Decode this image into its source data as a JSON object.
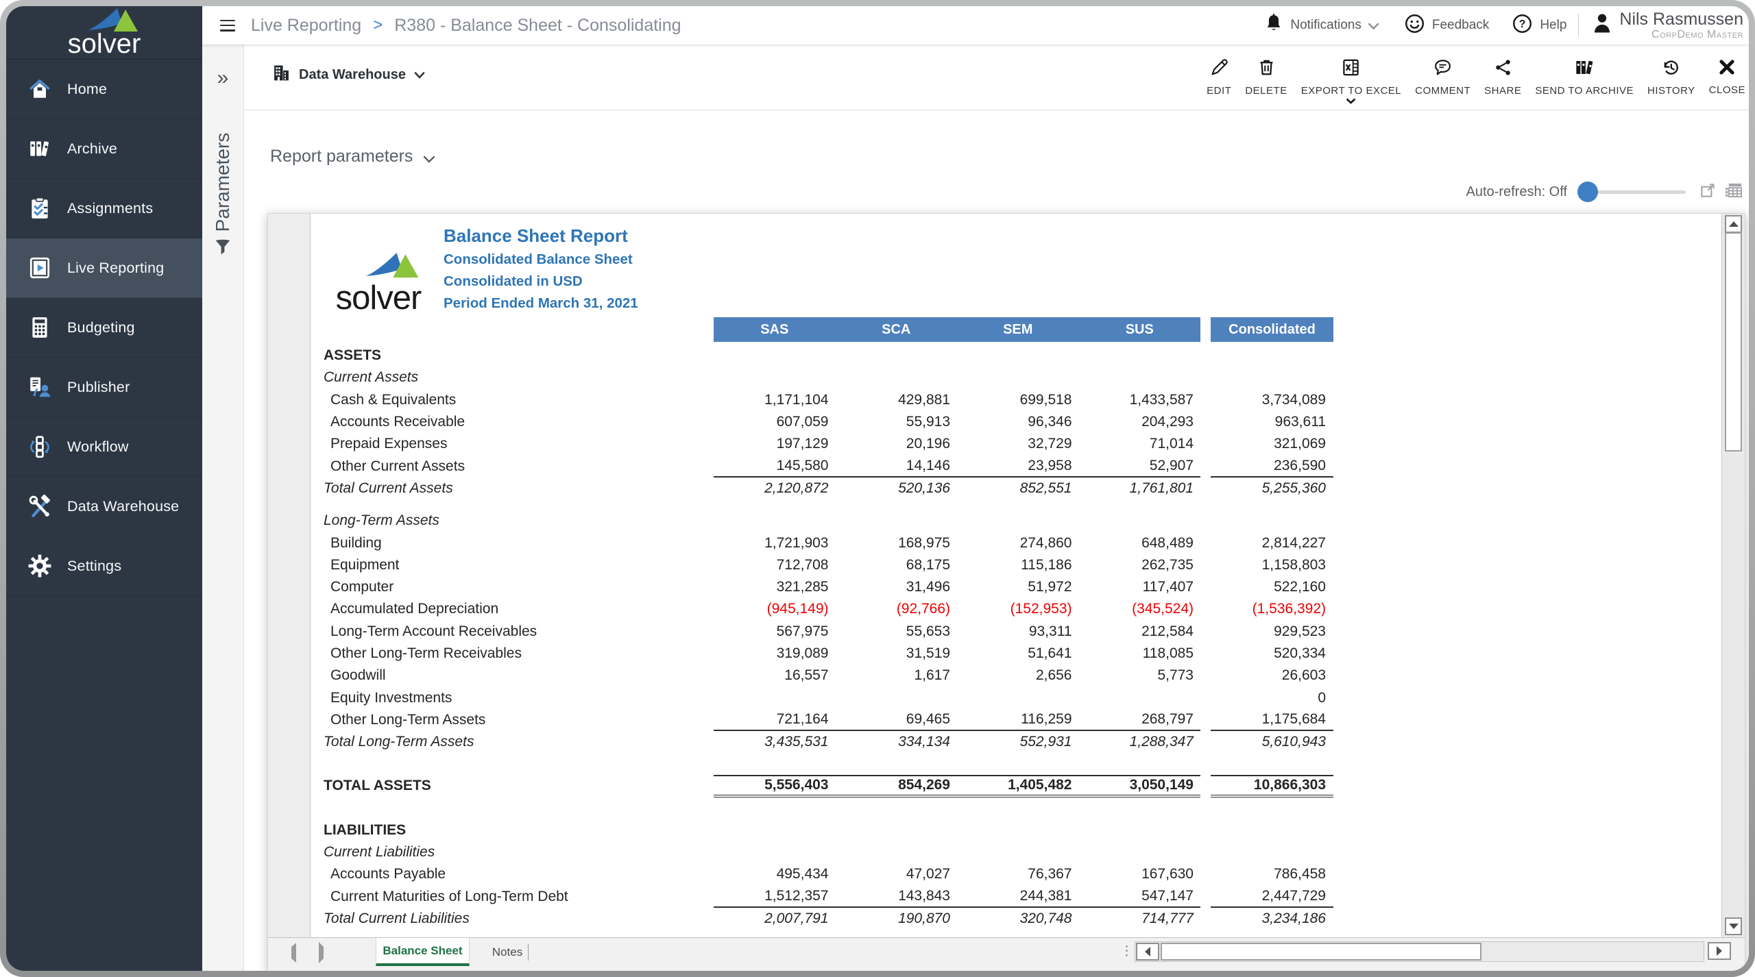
{
  "colors": {
    "sidebar-bg": "#2d3744",
    "sidebar-active": "#44505d",
    "accent-blue": "#3c7ddd",
    "icon-blue": "#4d8fd0",
    "band-blue": "#4f81bd",
    "title-blue": "#2e75b6",
    "neg-red": "#ee0000",
    "tab-green": "#1f7245",
    "knob-blue": "#3e80c3"
  },
  "sidebar": {
    "logo_text": "solver",
    "items": [
      {
        "label": "Home",
        "icon": "home-icon",
        "active": false
      },
      {
        "label": "Archive",
        "icon": "archive-icon",
        "active": false
      },
      {
        "label": "Assignments",
        "icon": "assignments-icon",
        "active": false
      },
      {
        "label": "Live Reporting",
        "icon": "live-reporting-icon",
        "active": true
      },
      {
        "label": "Budgeting",
        "icon": "budgeting-icon",
        "active": false
      },
      {
        "label": "Publisher",
        "icon": "publisher-icon",
        "active": false
      },
      {
        "label": "Workflow",
        "icon": "workflow-icon",
        "active": false
      },
      {
        "label": "Data Warehouse",
        "icon": "data-warehouse-icon",
        "active": false
      },
      {
        "label": "Settings",
        "icon": "settings-icon",
        "active": false
      }
    ]
  },
  "params_panel": {
    "title": "Parameters",
    "expand_glyph": "»"
  },
  "header": {
    "breadcrumb": {
      "section": "Live Reporting",
      "separator": ">",
      "page": "R380 - Balance Sheet - Consolidating"
    },
    "notifications_label": "Notifications",
    "feedback_label": "Feedback",
    "help_label": "Help",
    "user": {
      "name": "Nils Rasmussen",
      "org": "CorpDemo Master"
    }
  },
  "toolbar": {
    "source_label": "Data Warehouse",
    "actions": [
      {
        "label": "EDIT",
        "icon": "edit-icon",
        "has_dropdown": false
      },
      {
        "label": "DELETE",
        "icon": "delete-icon",
        "has_dropdown": false
      },
      {
        "label": "EXPORT TO EXCEL",
        "icon": "export-excel-icon",
        "has_dropdown": true
      },
      {
        "label": "COMMENT",
        "icon": "comment-icon",
        "has_dropdown": false
      },
      {
        "label": "SHARE",
        "icon": "share-icon",
        "has_dropdown": false
      },
      {
        "label": "SEND TO ARCHIVE",
        "icon": "send-to-archive-icon",
        "has_dropdown": false
      },
      {
        "label": "HISTORY",
        "icon": "history-icon",
        "has_dropdown": false
      },
      {
        "label": "CLOSE",
        "icon": "close-icon",
        "has_dropdown": false
      }
    ]
  },
  "report_parameters_label": "Report parameters",
  "auto_refresh": {
    "label": "Auto-refresh: Off"
  },
  "report": {
    "logo_text": "solver",
    "title": "Balance Sheet Report",
    "subtitles": [
      "Consolidated Balance Sheet",
      "Consolidated in USD",
      "Period Ended March 31, 2021"
    ],
    "columns": [
      "SAS",
      "SCA",
      "SEM",
      "SUS",
      "Consolidated"
    ],
    "rows": [
      {
        "style": "section",
        "label": "ASSETS"
      },
      {
        "style": "subsection",
        "label": "Current Assets"
      },
      {
        "style": "item",
        "label": "Cash & Equivalents",
        "values": [
          "1,171,104",
          "429,881",
          "699,518",
          "1,433,587",
          "3,734,089"
        ]
      },
      {
        "style": "item",
        "label": "Accounts Receivable",
        "values": [
          "607,059",
          "55,913",
          "96,346",
          "204,293",
          "963,611"
        ]
      },
      {
        "style": "item",
        "label": "Prepaid Expenses",
        "values": [
          "197,129",
          "20,196",
          "32,729",
          "71,014",
          "321,069"
        ]
      },
      {
        "style": "item underline",
        "label": "Other Current Assets",
        "values": [
          "145,580",
          "14,146",
          "23,958",
          "52,907",
          "236,590"
        ]
      },
      {
        "style": "total",
        "label": "Total Current Assets",
        "values": [
          "2,120,872",
          "520,136",
          "852,551",
          "1,761,801",
          "5,255,360"
        ]
      },
      {
        "style": "spacer",
        "h": 15
      },
      {
        "style": "subsection",
        "label": "Long-Term Assets"
      },
      {
        "style": "item",
        "label": "Building",
        "values": [
          "1,721,903",
          "168,975",
          "274,860",
          "648,489",
          "2,814,227"
        ]
      },
      {
        "style": "item",
        "label": "Equipment",
        "values": [
          "712,708",
          "68,175",
          "115,186",
          "262,735",
          "1,158,803"
        ]
      },
      {
        "style": "item",
        "label": "Computer",
        "values": [
          "321,285",
          "31,496",
          "51,972",
          "117,407",
          "522,160"
        ]
      },
      {
        "style": "item",
        "label": "Accumulated Depreciation",
        "values": [
          "(945,149)",
          "(92,766)",
          "(152,953)",
          "(345,524)",
          "(1,536,392)"
        ]
      },
      {
        "style": "item",
        "label": "Long-Term Account Receivables",
        "values": [
          "567,975",
          "55,653",
          "93,311",
          "212,584",
          "929,523"
        ]
      },
      {
        "style": "item",
        "label": "Other Long-Term Receivables",
        "values": [
          "319,089",
          "31,519",
          "51,641",
          "118,085",
          "520,334"
        ]
      },
      {
        "style": "item",
        "label": "Goodwill",
        "values": [
          "16,557",
          "1,617",
          "2,656",
          "5,773",
          "26,603"
        ]
      },
      {
        "style": "item",
        "label": "Equity Investments",
        "values": [
          "",
          "",
          "",
          "",
          "0"
        ]
      },
      {
        "style": "item underline",
        "label": "Other Long-Term Assets",
        "values": [
          "721,164",
          "69,465",
          "116,259",
          "268,797",
          "1,175,684"
        ]
      },
      {
        "style": "total",
        "label": "Total Long-Term Assets",
        "values": [
          "3,435,531",
          "334,134",
          "552,931",
          "1,288,347",
          "5,610,943"
        ]
      },
      {
        "style": "spacer",
        "h": 32
      },
      {
        "style": "grand",
        "label": "TOTAL ASSETS",
        "values": [
          "5,556,403",
          "854,269",
          "1,405,482",
          "3,050,149",
          "10,866,303"
        ]
      },
      {
        "style": "spacer",
        "h": 32
      },
      {
        "style": "section",
        "label": "LIABILITIES"
      },
      {
        "style": "subsection",
        "label": "Current Liabilities"
      },
      {
        "style": "item",
        "label": "Accounts Payable",
        "values": [
          "495,434",
          "47,027",
          "76,367",
          "167,630",
          "786,458"
        ]
      },
      {
        "style": "item underline",
        "label": "Current Maturities of Long-Term Debt",
        "values": [
          "1,512,357",
          "143,843",
          "244,381",
          "547,147",
          "2,447,729"
        ]
      },
      {
        "style": "total",
        "label": "Total Current Liabilities",
        "values": [
          "2,007,791",
          "190,870",
          "320,748",
          "714,777",
          "3,234,186"
        ]
      }
    ]
  },
  "sheet_tabs": {
    "tabs": [
      {
        "label": "Balance Sheet",
        "active": true
      },
      {
        "label": "Notes",
        "active": false
      }
    ]
  }
}
